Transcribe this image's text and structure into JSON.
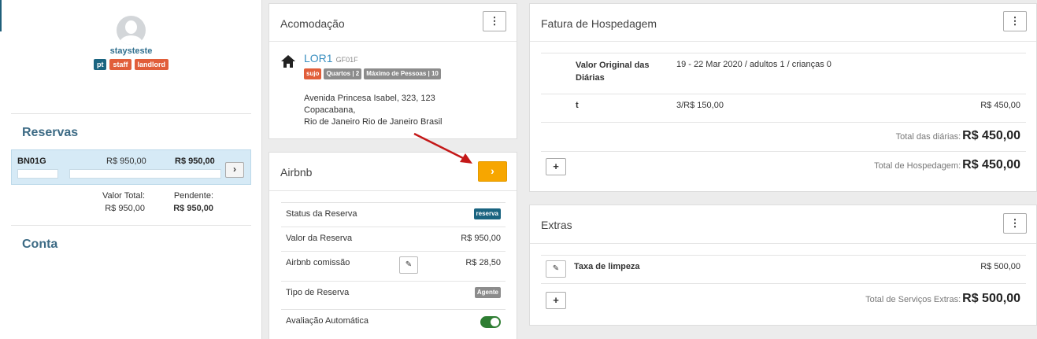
{
  "user": {
    "name": "staysteste",
    "badges": [
      {
        "label": "pt",
        "color": "#1a6480"
      },
      {
        "label": "staff",
        "color": "#e15e3a"
      },
      {
        "label": "landlord",
        "color": "#e15e3a"
      }
    ]
  },
  "reservas": {
    "title": "Reservas",
    "rows": [
      {
        "code": "BN01G",
        "value": "R$ 950,00",
        "pending": "R$ 950,00"
      }
    ],
    "total_label": "Valor Total:",
    "total_value": "R$ 950,00",
    "pending_label": "Pendente:",
    "pending_value": "R$ 950,00"
  },
  "conta": {
    "title": "Conta"
  },
  "acomodacao": {
    "title": "Acomodação",
    "unit": "LOR1",
    "unit_code": "GF01F",
    "tags": [
      "sujo",
      "Quartos | 2",
      "Máximo de Pessoas | 10"
    ],
    "address_lines": [
      "Avenida Princesa Isabel, 323, 123",
      "Copacabana,",
      "Rio de Janeiro Rio de Janeiro Brasil"
    ]
  },
  "airbnb": {
    "title": "Airbnb",
    "rows": [
      {
        "label": "Status da Reserva",
        "badge": "reserva",
        "badge_color": "#1a6480"
      },
      {
        "label": "Valor da Reserva",
        "value": "R$ 950,00"
      },
      {
        "label": "Airbnb comissão",
        "value": "R$ 28,50"
      },
      {
        "label": "Tipo de Reserva",
        "badge": "Agente",
        "badge_color": "#8c8c8c"
      },
      {
        "label": "Avaliação Automática",
        "toggle_on": true
      }
    ]
  },
  "fatura": {
    "title": "Fatura de Hospedagem",
    "original_label": "Valor Original das Diárias",
    "original_desc": "19 - 22 Mar 2020  /  adultos 1 /  crianças 0",
    "line_name": "t",
    "line_qty": "3/R$ 150,00",
    "line_total": "R$ 450,00",
    "total_diarias_label": "Total das diárias:",
    "total_diarias_value": "R$ 450,00",
    "total_hospedagem_label": "Total de Hospedagem:",
    "total_hospedagem_value": "R$ 450,00"
  },
  "extras": {
    "title": "Extras",
    "item_name": "Taxa de limpeza",
    "item_value": "R$ 500,00",
    "total_label": "Total de Serviços Extras:",
    "total_value": "R$ 500,00"
  },
  "colors": {
    "accent_orange": "#f7a600",
    "link_blue": "#3a8fc0",
    "toggle_green": "#2e7d32"
  }
}
